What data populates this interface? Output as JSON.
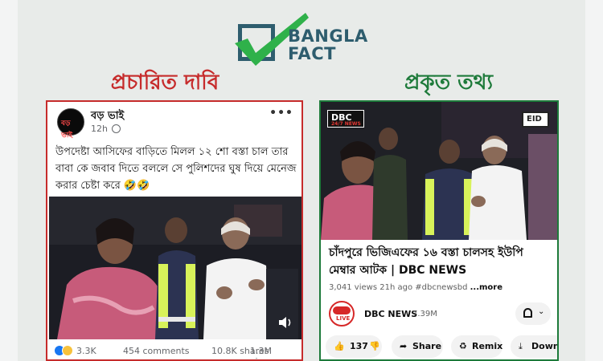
{
  "brand": {
    "line1": "BANGLA",
    "line2": "FACT"
  },
  "headings": {
    "claim": "প্রচারিত দাবি",
    "fact": "প্রকৃত তথ্য"
  },
  "colors": {
    "claim_red": "#c62b2b",
    "fact_green": "#1d7a3a",
    "brand_teal": "#2e5d6e",
    "check_green": "#2fb14a"
  },
  "facebook_post": {
    "avatar_text": "বড় ভাই",
    "page_name": "বড় ভাই",
    "time": "12h",
    "text": "উপদেষ্টা আসিফের বাড়িতে মিলল ১২ শো বস্তা চাল তার বাবা কে জবাব দিতে বললে সে পুলিশদের ঘুষ দিয়ে মেনেজ করার চেষ্টা করে 🤣🤣",
    "reactions": "3.3K",
    "comments": "454 comments",
    "shares": "10.8K shares",
    "views": "1.3M views",
    "icons": [
      "globe-icon",
      "more-options-icon",
      "volume-icon",
      "like-reaction-icon",
      "haha-reaction-icon"
    ]
  },
  "youtube_video": {
    "channel_tag": "DBC",
    "channel_tag_sub": "24/7 NEWS",
    "overlay_tag": "EID",
    "title": "চাঁদপুরে ভিজিএফের ১৬ বস্তা চালসহ ইউপি মেম্বার আটক | DBC NEWS",
    "views": "3,041 views",
    "age": "21h ago",
    "hashtag": "#dbcnewsbd",
    "more": "...more",
    "channel_name": "DBC NEWS",
    "subscribers": "7.39M",
    "avatar_top": "DBC",
    "avatar_bottom": "LIVE",
    "likes": "137",
    "share_label": "Share",
    "remix_label": "Remix",
    "download_label": "Downlo",
    "icons": [
      "bell-icon",
      "chevron-down-icon",
      "like-icon",
      "dislike-icon",
      "share-icon",
      "remix-icon",
      "download-icon"
    ]
  }
}
